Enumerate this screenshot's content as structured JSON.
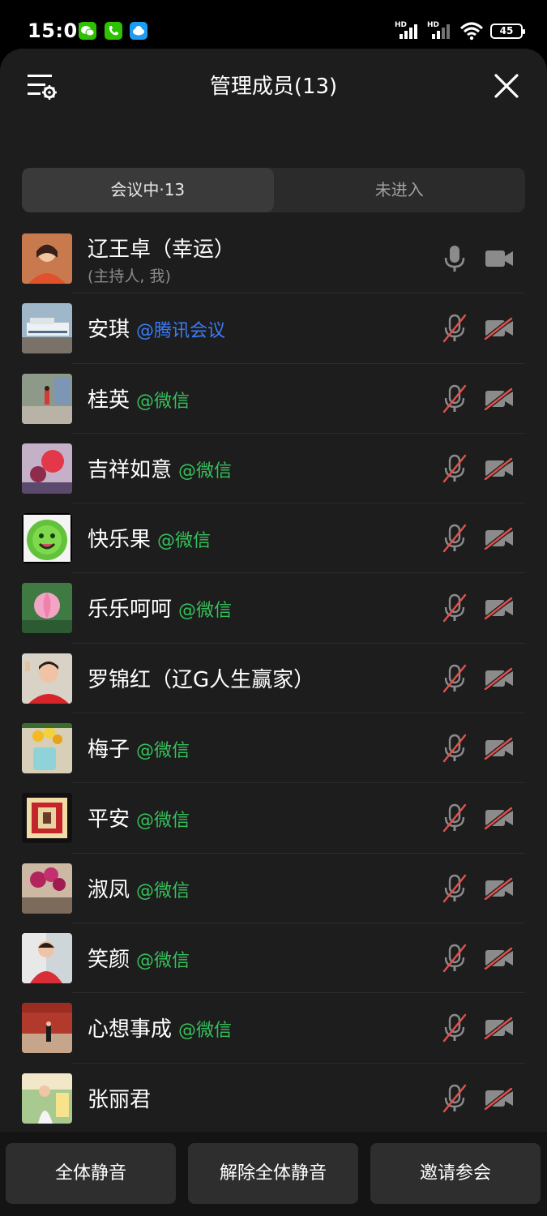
{
  "status_bar": {
    "time": "15:07",
    "battery": "45",
    "signal1": "HD",
    "signal2": "HD"
  },
  "header": {
    "title": "管理成员(13)"
  },
  "tabs": [
    {
      "label": "会议中·13",
      "active": true
    },
    {
      "label": "未进入",
      "active": false
    }
  ],
  "members": [
    {
      "name": "辽王卓（幸运）",
      "tag": "",
      "role": "(主持人, 我)",
      "mic": "on",
      "camera": "off"
    },
    {
      "name": "安琪",
      "tag": "@腾讯会议",
      "tag_type": "tencent",
      "mic": "muted",
      "camera": "off"
    },
    {
      "name": "桂英",
      "tag": "@微信",
      "tag_type": "wechat",
      "mic": "muted",
      "camera": "off"
    },
    {
      "name": "吉祥如意",
      "tag": "@微信",
      "tag_type": "wechat",
      "mic": "muted",
      "camera": "off"
    },
    {
      "name": "快乐果",
      "tag": "@微信",
      "tag_type": "wechat",
      "mic": "muted",
      "camera": "off"
    },
    {
      "name": "乐乐呵呵",
      "tag": "@微信",
      "tag_type": "wechat",
      "mic": "muted",
      "camera": "off"
    },
    {
      "name": "罗锦红（辽G人生赢家）",
      "tag": "",
      "tag_type": "",
      "mic": "muted",
      "camera": "off"
    },
    {
      "name": "梅子",
      "tag": "@微信",
      "tag_type": "wechat",
      "mic": "muted",
      "camera": "off"
    },
    {
      "name": "平安",
      "tag": "@微信",
      "tag_type": "wechat",
      "mic": "muted",
      "camera": "off"
    },
    {
      "name": "淑凤",
      "tag": "@微信",
      "tag_type": "wechat",
      "mic": "muted",
      "camera": "off"
    },
    {
      "name": "笑颜",
      "tag": "@微信",
      "tag_type": "wechat",
      "mic": "muted",
      "camera": "off"
    },
    {
      "name": "心想事成",
      "tag": "@微信",
      "tag_type": "wechat",
      "mic": "muted",
      "camera": "off"
    },
    {
      "name": "张丽君",
      "tag": "",
      "tag_type": "",
      "mic": "muted",
      "camera": "off"
    }
  ],
  "footer": {
    "mute_all": "全体静音",
    "unmute_all": "解除全体静音",
    "invite": "邀请参会"
  }
}
